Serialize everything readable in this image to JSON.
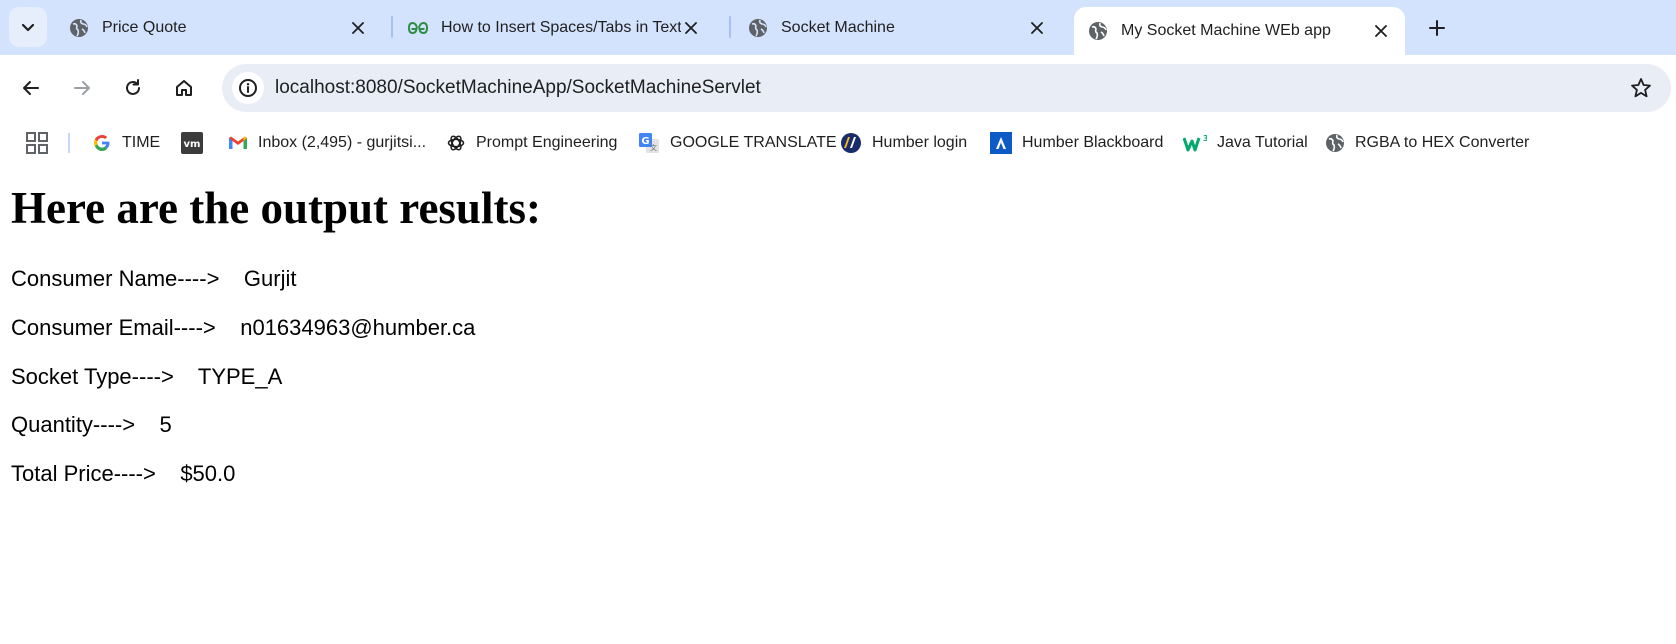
{
  "tabs": [
    {
      "title": "Price Quote",
      "icon": "globe-icon",
      "active": false
    },
    {
      "title": "How to Insert Spaces/Tabs in Text",
      "icon": "geeksforgeeks-icon",
      "active": false
    },
    {
      "title": "Socket Machine",
      "icon": "globe-icon",
      "active": false
    },
    {
      "title": "My Socket Machine WEb app",
      "icon": "globe-icon",
      "active": true
    }
  ],
  "address_bar": {
    "url": "localhost:8080/SocketMachineApp/SocketMachineServlet"
  },
  "bookmarks": [
    {
      "label": "TIME",
      "icon": "google-icon"
    },
    {
      "label": "",
      "icon": "vm-icon"
    },
    {
      "label": "Inbox (2,495) - gurjitsi...",
      "icon": "gmail-icon"
    },
    {
      "label": "Prompt Engineering",
      "icon": "openai-icon"
    },
    {
      "label": "GOOGLE TRANSLATE",
      "icon": "google-translate-icon"
    },
    {
      "label": "Humber login",
      "icon": "humber-icon"
    },
    {
      "label": "Humber Blackboard",
      "icon": "blackboard-icon"
    },
    {
      "label": "Java Tutorial",
      "icon": "w3schools-icon"
    },
    {
      "label": "RGBA to HEX Converter",
      "icon": "globe-icon"
    }
  ],
  "page": {
    "heading": "Here are the output results:",
    "results": [
      {
        "label": "Consumer Name---->",
        "value": "Gurjit"
      },
      {
        "label": "Consumer Email---->",
        "value": "n01634963@humber.ca"
      },
      {
        "label": "Socket Type---->",
        "value": "TYPE_A"
      },
      {
        "label": "Quantity---->",
        "value": "5"
      },
      {
        "label": "Total Price---->",
        "value": "$50.0"
      }
    ]
  },
  "colors": {
    "tabstrip": "#d3e3fd",
    "omnibox": "#e9eef6",
    "gfg_green": "#2f8d46",
    "google_blue": "#4285f4"
  }
}
